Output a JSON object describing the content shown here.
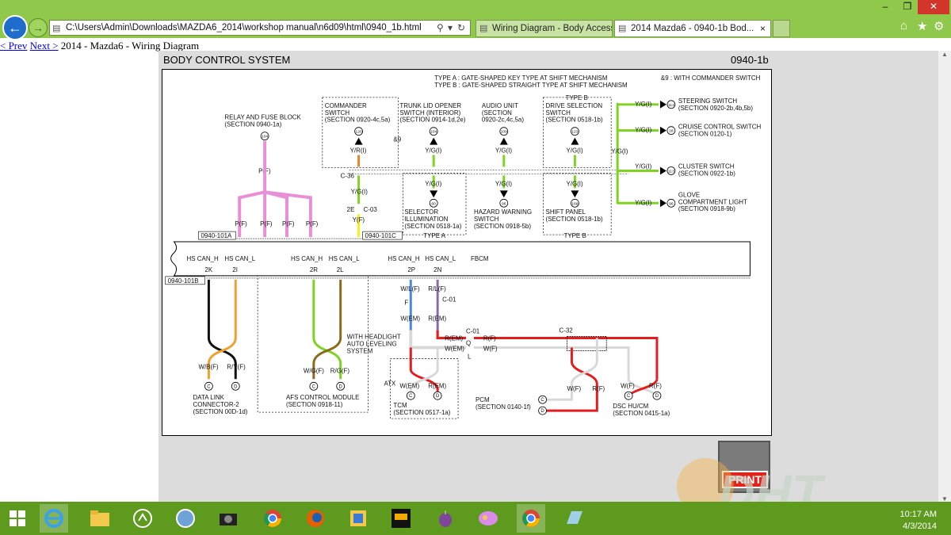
{
  "browser": {
    "address_url": "C:\\Users\\Admin\\Downloads\\MAZDA6_2014\\workshop manual\\n6d09\\html\\0940_1b.html",
    "tabs": [
      {
        "label": "Wiring Diagram - Body Access..."
      },
      {
        "label": "2014 Mazda6 - 0940-1b Bod...",
        "close": "×"
      }
    ],
    "window_controls": {
      "minimize": "–",
      "restore": "❐",
      "close": "✕"
    }
  },
  "page": {
    "prev_link": "< Prev",
    "next_link": "Next >",
    "heading": "2014 - Mazda6 - Wiring Diagram"
  },
  "diagram": {
    "title": "BODY CONTROL SYSTEM",
    "code": "0940-1b",
    "notes": {
      "type_a": "TYPE A : GATE-SHAPED KEY TYPE AT SHIFT MECHANISM",
      "type_b": "TYPE B : GATE-SHAPED STRAIGHT TYPE AT SHIFT MECHANISM",
      "commander": "&9 : WITH COMMANDER SWITCH",
      "amp9": "&9"
    },
    "relay": {
      "name": "RELAY AND FUSE BLOCK",
      "section": "(SECTION 0940-1a)",
      "pin": "104",
      "wire": "P(F)",
      "pins": [
        {
          "wire": "P(F)",
          "pin": "1A"
        },
        {
          "wire": "P(F)",
          "pin": "1B"
        },
        {
          "wire": "P(F)",
          "pin": "3K"
        },
        {
          "wire": "P(F)",
          "pin": "3L"
        }
      ]
    },
    "commander": {
      "name": "COMMANDER",
      "name2": "SWITCH",
      "section": "(SECTION 0920-4c,5a)",
      "pin": "120",
      "wire": "Y/R(I)"
    },
    "trunk": {
      "name": "TRUNK LID OPENER",
      "name2": "SWITCH (INTERIOR)",
      "section": "(SECTION 0914-1d,2e)",
      "pin": "104",
      "wire": "Y/G(I)"
    },
    "audio": {
      "name": "AUDIO UNIT",
      "name2": "(SECTION",
      "section": "0920-2c,4c,5a)",
      "pin": "109",
      "wire": "Y/G(I)"
    },
    "drive": {
      "type": "TYPE B",
      "name": "DRIVE SELECTION",
      "name2": "SWITCH",
      "section": "(SECTION 0518-1b)",
      "pin": "123",
      "wire": "Y/G(I)"
    },
    "bus": {
      "label": "C-36",
      "wire": "Y/G(I)"
    },
    "junction": {
      "pin_a": "2E",
      "conn": "C-03",
      "wire_f": "Y(F)",
      "pin": "3J"
    },
    "selector": {
      "name": "SELECTOR",
      "name2": "ILLUMINATION",
      "section": "(SECTION 0518-1a)",
      "type": "TYPE A",
      "pin": "60",
      "wire": "Y/G(I)"
    },
    "hazard": {
      "name": "HAZARD WARNING",
      "name2": "SWITCH",
      "section": "(SECTION 0918-5b)",
      "pin": "96",
      "wire": "Y/G(I)"
    },
    "shift": {
      "name": "SHIFT PANEL",
      "section": "(SECTION 0518-1b)",
      "type": "TYPE B",
      "pin": "168",
      "wire": "Y/G(I)"
    },
    "right_outputs": [
      {
        "wire": "Y/G(I)",
        "pin": "113",
        "name": "STEERING SWITCH",
        "section": "(SECTION 0920-2b,4b,5b)"
      },
      {
        "wire": "Y/G(I)",
        "pin": "28",
        "name": "CRUISE CONTROL SWITCH",
        "section": "(SECTION 0120-1)"
      },
      {
        "wire": "Y/G(I)",
        "pin": "113",
        "name": "CLUSTER SWITCH",
        "section": "(SECTION 0922-1b)"
      },
      {
        "wire": "Y/G(I)",
        "pin": "96",
        "name": "GLOVE",
        "name2": "COMPARTMENT LIGHT",
        "section": "(SECTION 0918-9b)"
      }
    ],
    "right_bus_wire": "Y/G(I)",
    "fbcm": {
      "name": "FBCM",
      "conn_a": "0940-101A",
      "conn_b": "0940-101B",
      "conn_c": "0940-101C",
      "can_labels": [
        "HS CAN_H",
        "HS CAN_L",
        "HS CAN_H",
        "HS CAN_L",
        "HS CAN_H",
        "HS CAN_L"
      ],
      "can_pins": [
        "2K",
        "2I",
        "2R",
        "2L",
        "2P",
        "2N"
      ]
    },
    "dlc": {
      "w1": "W/B(F)",
      "w2": "R/Y(F)",
      "p1": "C",
      "p2": "D",
      "name": "DATA LINK",
      "name2": "CONNECTOR-2",
      "section": "(SECTION 00D-1d)"
    },
    "afs": {
      "w1": "W/G(F)",
      "w2": "R/G(F)",
      "p1": "C",
      "p2": "D",
      "name": "AFS CONTROL MODULE",
      "section": "(SECTION 0918-11)",
      "note1": "WITH HEADLIGHT",
      "note2": "AUTO LEVELING",
      "note3": "SYSTEM"
    },
    "tcm_path": {
      "w_lf": "W/L(F)",
      "r_lf": "R/L(F)",
      "f": "F",
      "c01": "C-01",
      "w_em": "W(EM)",
      "r_em": "R(EM)",
      "r_em2": "R(EM)",
      "w_em2": "W(EM)",
      "c01b": "C-01",
      "q": "Q",
      "l": "L",
      "r_f": "R(F)",
      "w_f": "W(F)",
      "c32": "C-32"
    },
    "tcm": {
      "atx": "ATX",
      "w": "W(EM)",
      "r": "R(EM)",
      "p1": "C",
      "p2": "D",
      "name": "TCM",
      "section": "(SECTION 0517-1a)"
    },
    "pcm": {
      "name": "PCM",
      "section": "(SECTION 0140-1f)",
      "w": "W(F)",
      "r": "R(F)",
      "p1": "C",
      "p2": "D"
    },
    "dsc": {
      "w": "W(F)",
      "r": "R(F)",
      "p1": "C",
      "p2": "D",
      "name": "DSC HU/CM",
      "section": "(SECTION 0415-1a)"
    }
  },
  "print_label": "PRINT",
  "watermark": "DHT",
  "taskbar": {
    "clock_time": "10:17 AM",
    "clock_date": "4/3/2014"
  }
}
